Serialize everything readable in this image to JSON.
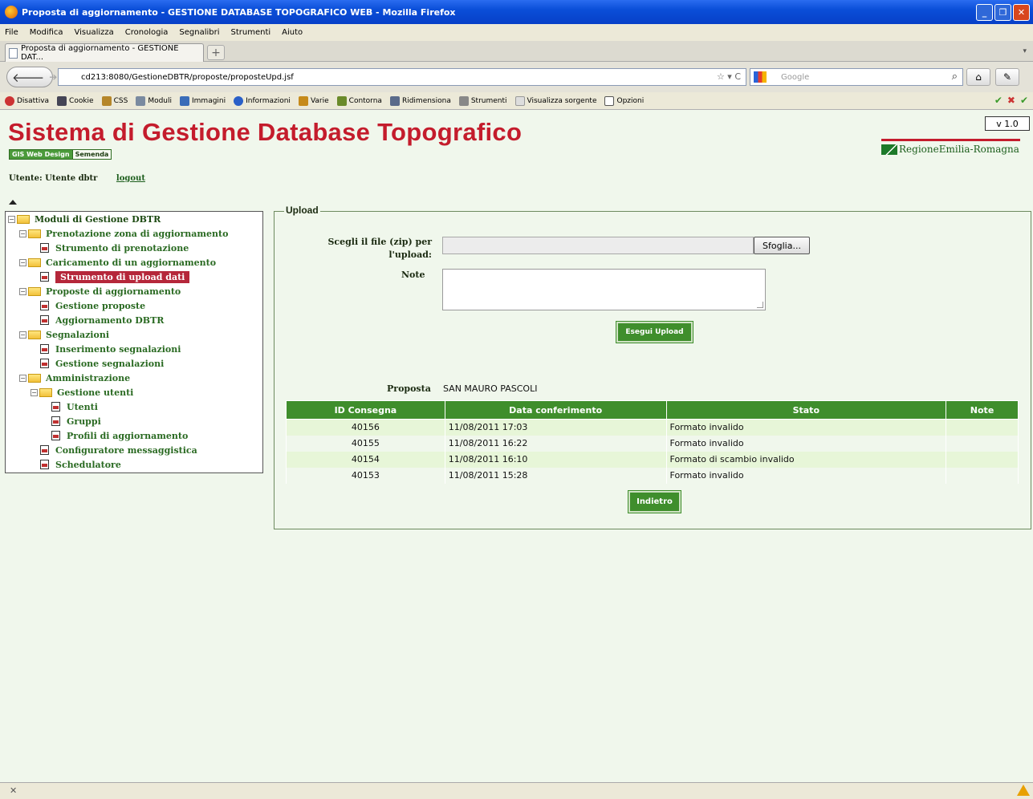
{
  "browser": {
    "window_title": "Proposta di aggiornamento - GESTIONE DATABASE TOPOGRAFICO WEB - Mozilla Firefox",
    "menu": [
      "File",
      "Modifica",
      "Visualizza",
      "Cronologia",
      "Segnalibri",
      "Strumenti",
      "Aiuto"
    ],
    "tab_title": "Proposta di aggiornamento - GESTIONE DAT...",
    "url": "cd213:8080/GestioneDBTR/proposte/proposteUpd.jsf",
    "search_placeholder": "Google",
    "devbar": [
      "Disattiva",
      "Cookie",
      "CSS",
      "Moduli",
      "Immagini",
      "Informazioni",
      "Varie",
      "Contorna",
      "Ridimensiona",
      "Strumenti",
      "Visualizza sorgente",
      "Opzioni"
    ],
    "colors": {
      "titlebar": "#0a4ed8",
      "chrome": "#ece9d8"
    }
  },
  "header": {
    "title": "Sistema di Gestione Database Topografico",
    "badge_gis": "GIS Web Design",
    "badge_sem": "Semenda",
    "version": "v 1.0",
    "region_logo": "RegioneEmilia-Romagna",
    "user": "Utente: Utente dbtr",
    "logout": "logout",
    "colors": {
      "title": "#c41c2c",
      "green": "#3f8e2c",
      "page_bg": "#f0f7ec"
    }
  },
  "tree": {
    "root": "Moduli di Gestione DBTR",
    "items": [
      {
        "label": "Prenotazione zona di aggiornamento"
      },
      {
        "label": "Strumento di prenotazione"
      },
      {
        "label": "Caricamento di un aggiornamento"
      },
      {
        "label": "Strumento di upload dati"
      },
      {
        "label": "Proposte di aggiornamento"
      },
      {
        "label": "Gestione proposte"
      },
      {
        "label": "Aggiornamento DBTR"
      },
      {
        "label": "Segnalazioni"
      },
      {
        "label": "Inserimento segnalazioni"
      },
      {
        "label": "Gestione segnalazioni"
      },
      {
        "label": "Amministrazione"
      },
      {
        "label": "Gestione utenti"
      },
      {
        "label": "Utenti"
      },
      {
        "label": "Gruppi"
      },
      {
        "label": "Profili di aggiornamento"
      },
      {
        "label": "Configuratore messaggistica"
      },
      {
        "label": "Schedulatore"
      }
    ]
  },
  "upload": {
    "legend": "Upload",
    "file_label": "Scegli il file (zip) per l'upload:",
    "browse_label": "Sfoglia...",
    "note_label": "Note",
    "exec_label": "Esegui Upload",
    "proposal_label": "Proposta",
    "proposal_value": "SAN MAURO PASCOLI",
    "table": {
      "headers": [
        "ID Consegna",
        "Data conferimento",
        "Stato",
        "Note"
      ],
      "rows": [
        [
          "40156",
          "11/08/2011 17:03",
          "Formato invalido",
          ""
        ],
        [
          "40155",
          "11/08/2011 16:22",
          "Formato invalido",
          ""
        ],
        [
          "40154",
          "11/08/2011 16:10",
          "Formato di scambio invalido",
          ""
        ],
        [
          "40153",
          "11/08/2011 15:28",
          "Formato invalido",
          ""
        ]
      ]
    },
    "back_label": "Indietro"
  }
}
